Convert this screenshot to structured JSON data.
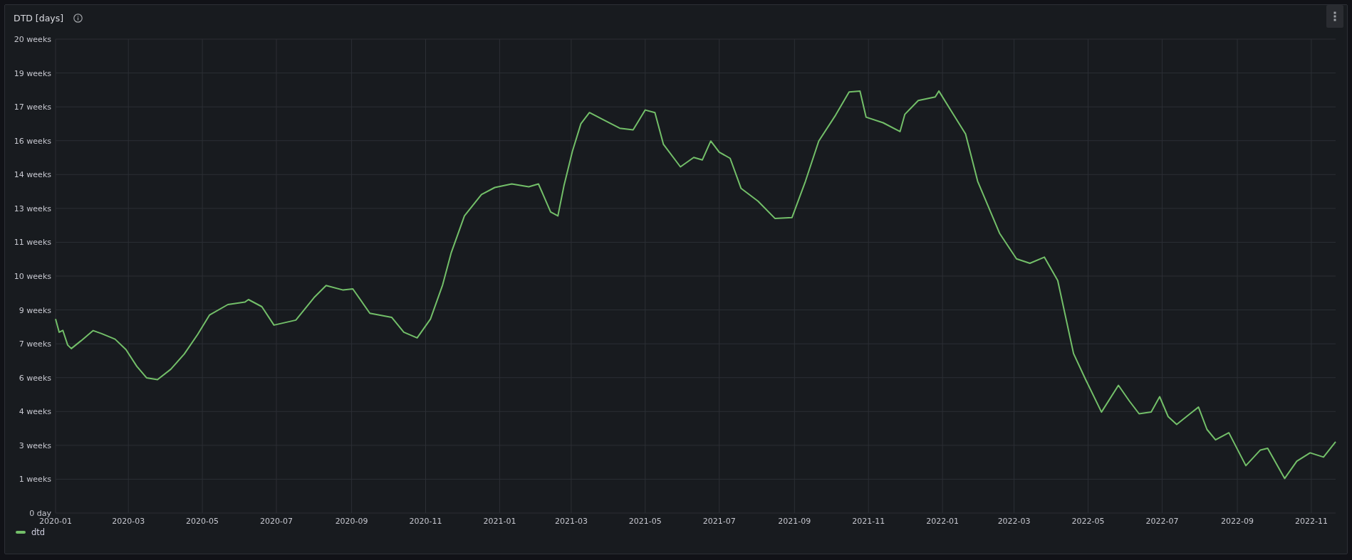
{
  "panel": {
    "title": "DTD [days]",
    "chart_data": {
      "type": "line",
      "grid": true,
      "xlim": [
        "2020-01-01",
        "2022-11-21"
      ],
      "ylim": [
        0,
        20
      ],
      "xticks": [
        {
          "value": "2020-01-01",
          "label": "2020-01"
        },
        {
          "value": "2020-03-01",
          "label": "2020-03"
        },
        {
          "value": "2020-05-01",
          "label": "2020-05"
        },
        {
          "value": "2020-07-01",
          "label": "2020-07"
        },
        {
          "value": "2020-09-01",
          "label": "2020-09"
        },
        {
          "value": "2020-11-01",
          "label": "2020-11"
        },
        {
          "value": "2021-01-01",
          "label": "2021-01"
        },
        {
          "value": "2021-03-01",
          "label": "2021-03"
        },
        {
          "value": "2021-05-01",
          "label": "2021-05"
        },
        {
          "value": "2021-07-01",
          "label": "2021-07"
        },
        {
          "value": "2021-09-01",
          "label": "2021-09"
        },
        {
          "value": "2021-11-01",
          "label": "2021-11"
        },
        {
          "value": "2022-01-01",
          "label": "2022-01"
        },
        {
          "value": "2022-03-01",
          "label": "2022-03"
        },
        {
          "value": "2022-05-01",
          "label": "2022-05"
        },
        {
          "value": "2022-07-01",
          "label": "2022-07"
        },
        {
          "value": "2022-09-01",
          "label": "2022-09"
        },
        {
          "value": "2022-11-01",
          "label": "2022-11"
        }
      ],
      "yticks": [
        {
          "value": 0,
          "label": "0 day"
        },
        {
          "value": 1.4286,
          "label": "1 weeks"
        },
        {
          "value": 2.8571,
          "label": "3 weeks"
        },
        {
          "value": 4.2857,
          "label": "4 weeks"
        },
        {
          "value": 5.7143,
          "label": "6 weeks"
        },
        {
          "value": 7.1429,
          "label": "7 weeks"
        },
        {
          "value": 8.5714,
          "label": "9 weeks"
        },
        {
          "value": 10,
          "label": "10 weeks"
        },
        {
          "value": 11.4286,
          "label": "11 weeks"
        },
        {
          "value": 12.8571,
          "label": "13 weeks"
        },
        {
          "value": 14.2857,
          "label": "14 weeks"
        },
        {
          "value": 15.7143,
          "label": "16 weeks"
        },
        {
          "value": 17.1429,
          "label": "17 weeks"
        },
        {
          "value": 18.5714,
          "label": "19 weeks"
        },
        {
          "value": 20,
          "label": "20 weeks"
        }
      ],
      "x": [
        "2020-01-01",
        "2020-01-04",
        "2020-01-07",
        "2020-01-11",
        "2020-01-14",
        "2020-01-22",
        "2020-02-01",
        "2020-02-08",
        "2020-02-19",
        "2020-02-28",
        "2020-03-08",
        "2020-03-16",
        "2020-03-25",
        "2020-04-05",
        "2020-04-16",
        "2020-04-27",
        "2020-05-07",
        "2020-05-22",
        "2020-06-05",
        "2020-06-08",
        "2020-06-19",
        "2020-06-29",
        "2020-07-17",
        "2020-08-01",
        "2020-08-11",
        "2020-08-25",
        "2020-09-02",
        "2020-09-16",
        "2020-10-04",
        "2020-10-14",
        "2020-10-25",
        "2020-11-05",
        "2020-11-15",
        "2020-11-22",
        "2020-12-03",
        "2020-12-17",
        "2020-12-28",
        "2021-01-11",
        "2021-01-25",
        "2021-02-02",
        "2021-02-12",
        "2021-02-18",
        "2021-02-23",
        "2021-03-02",
        "2021-03-09",
        "2021-03-16",
        "2021-03-27",
        "2021-04-10",
        "2021-04-21",
        "2021-05-01",
        "2021-05-09",
        "2021-05-16",
        "2021-05-30",
        "2021-06-10",
        "2021-06-17",
        "2021-06-24",
        "2021-07-01",
        "2021-07-10",
        "2021-07-19",
        "2021-08-02",
        "2021-08-16",
        "2021-08-30",
        "2021-09-10",
        "2021-09-21",
        "2021-10-05",
        "2021-10-16",
        "2021-10-25",
        "2021-10-30",
        "2021-11-13",
        "2021-11-27",
        "2021-12-01",
        "2021-12-12",
        "2021-12-26",
        "2021-12-29",
        "2022-01-09",
        "2022-01-20",
        "2022-01-30",
        "2022-02-17",
        "2022-03-03",
        "2022-03-14",
        "2022-03-26",
        "2022-04-06",
        "2022-04-19",
        "2022-04-29",
        "2022-05-12",
        "2022-05-26",
        "2022-06-04",
        "2022-06-12",
        "2022-06-22",
        "2022-06-29",
        "2022-07-06",
        "2022-07-13",
        "2022-07-24",
        "2022-07-31",
        "2022-08-07",
        "2022-08-14",
        "2022-08-25",
        "2022-09-08",
        "2022-09-20",
        "2022-09-26",
        "2022-10-10",
        "2022-10-20",
        "2022-10-31",
        "2022-11-11",
        "2022-11-21"
      ],
      "series": [
        {
          "name": "dtd",
          "color": "#73bf69",
          "values": [
            8.19,
            7.63,
            7.71,
            7.09,
            6.94,
            7.27,
            7.7,
            7.57,
            7.34,
            6.9,
            6.19,
            5.71,
            5.63,
            6.07,
            6.71,
            7.53,
            8.36,
            8.8,
            8.9,
            9.01,
            8.71,
            7.93,
            8.14,
            9.09,
            9.6,
            9.41,
            9.46,
            8.43,
            8.26,
            7.63,
            7.39,
            8.19,
            9.63,
            10.97,
            12.54,
            13.44,
            13.74,
            13.89,
            13.77,
            13.89,
            12.71,
            12.54,
            13.81,
            15.27,
            16.43,
            16.9,
            16.61,
            16.24,
            16.17,
            17.01,
            16.9,
            15.56,
            14.61,
            15.01,
            14.9,
            15.7,
            15.23,
            14.97,
            13.7,
            13.16,
            12.43,
            12.47,
            14,
            15.7,
            16.8,
            17.77,
            17.81,
            16.71,
            16.47,
            16.1,
            16.83,
            17.41,
            17.56,
            17.81,
            16.9,
            16,
            14,
            11.81,
            10.73,
            10.54,
            10.8,
            9.81,
            6.73,
            5.63,
            4.26,
            5.39,
            4.73,
            4.19,
            4.26,
            4.91,
            4.07,
            3.74,
            4.19,
            4.47,
            3.53,
            3.09,
            3.39,
            2,
            2.66,
            2.73,
            1.46,
            2.19,
            2.54,
            2.36,
            3.01
          ]
        }
      ]
    }
  }
}
